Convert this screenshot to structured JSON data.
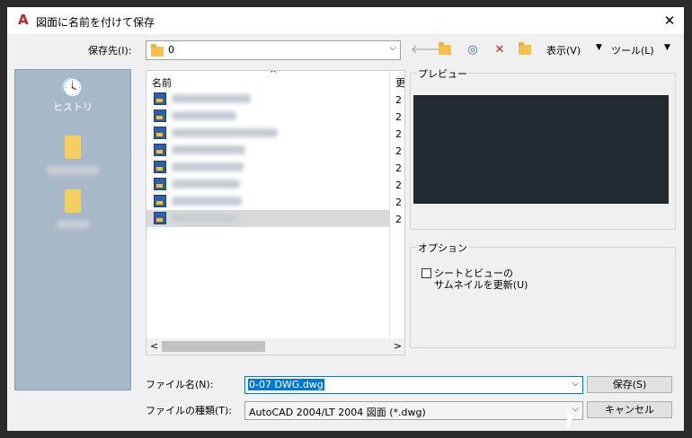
{
  "dialog": {
    "title": "図面に名前を付けて保存",
    "close_glyph": "✕",
    "app_icon": "autocad-icon"
  },
  "savein": {
    "label": "保存先(I):",
    "value": "0"
  },
  "toolbar": {
    "view_label": "表示(V)",
    "tools_label": "ツール(L)"
  },
  "places": [
    {
      "label": "ヒストリ",
      "icon": "history-icon"
    }
  ],
  "filelist": {
    "col_name": "名前",
    "col_date": "更",
    "rows": [
      {
        "date": "2",
        "selected": false
      },
      {
        "date": "2",
        "selected": false
      },
      {
        "date": "2",
        "selected": false
      },
      {
        "date": "2",
        "selected": false
      },
      {
        "date": "2",
        "selected": false
      },
      {
        "date": "2",
        "selected": false
      },
      {
        "date": "2",
        "selected": false
      },
      {
        "date": "2",
        "selected": true
      }
    ]
  },
  "preview": {
    "label": "プレビュー"
  },
  "options": {
    "label": "オプション",
    "thumbnail_line1": "シートとビューの",
    "thumbnail_line2": "サムネイルを更新(U)"
  },
  "filename": {
    "label": "ファイル名(N):",
    "value": "0-07 DWG.dwg"
  },
  "filetype": {
    "label": "ファイルの種類(T):",
    "value": "AutoCAD 2004/LT 2004 図面 (*.dwg)"
  },
  "buttons": {
    "save": "保存(S)",
    "cancel": "キャンセル"
  }
}
